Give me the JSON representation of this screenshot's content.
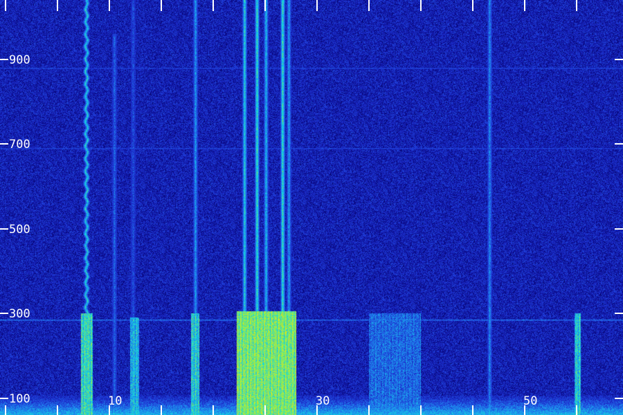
{
  "chart_data": {
    "type": "heatmap",
    "title": "",
    "xlabel": "",
    "ylabel": "",
    "x_ticks": [
      {
        "value": 0
      },
      {
        "value": 5
      },
      {
        "value": 10,
        "label": "10"
      },
      {
        "value": 15
      },
      {
        "value": 20
      },
      {
        "value": 25
      },
      {
        "value": 30,
        "label": "30"
      },
      {
        "value": 35
      },
      {
        "value": 40
      },
      {
        "value": 45
      },
      {
        "value": 50,
        "label": "50"
      },
      {
        "value": 55
      }
    ],
    "y_ticks": [
      {
        "value": 100,
        "label": "100"
      },
      {
        "value": 300,
        "label": "300"
      },
      {
        "value": 500,
        "label": "500"
      },
      {
        "value": 700,
        "label": "700"
      },
      {
        "value": 900,
        "label": "900"
      }
    ],
    "xlim": [
      -0.5,
      59.5
    ],
    "ylim": [
      60,
      1040
    ],
    "grid": false,
    "colormap": [
      "#000014",
      "#0a0a8c",
      "#1e32d2",
      "#1e8cf0",
      "#14dcdc",
      "#a0f03c",
      "#f0e614",
      "#e63c14"
    ],
    "background_intensity": 0.22,
    "features": [
      {
        "kind": "vertical_band",
        "x": 7.8,
        "y_from": 60,
        "y_to": 1040,
        "intensity": 0.55,
        "wobbly": true
      },
      {
        "kind": "vertical_band",
        "x": 10.5,
        "y_from": 60,
        "y_to": 960,
        "intensity": 0.36
      },
      {
        "kind": "vertical_band",
        "x": 12.3,
        "y_from": 60,
        "y_to": 1040,
        "intensity": 0.32
      },
      {
        "kind": "vertical_band",
        "x": 18.3,
        "y_from": 60,
        "y_to": 1040,
        "intensity": 0.45
      },
      {
        "kind": "vertical_band",
        "x": 23.0,
        "y_from": 60,
        "y_to": 1040,
        "intensity": 0.55
      },
      {
        "kind": "vertical_band",
        "x": 24.2,
        "y_from": 60,
        "y_to": 1040,
        "intensity": 0.6
      },
      {
        "kind": "vertical_band",
        "x": 25.1,
        "y_from": 60,
        "y_to": 1040,
        "intensity": 0.5
      },
      {
        "kind": "vertical_band",
        "x": 26.7,
        "y_from": 60,
        "y_to": 1040,
        "intensity": 0.6
      },
      {
        "kind": "vertical_band",
        "x": 27.3,
        "y_from": 60,
        "y_to": 1040,
        "intensity": 0.45
      },
      {
        "kind": "vertical_band",
        "x": 46.6,
        "y_from": 60,
        "y_to": 1040,
        "intensity": 0.42
      },
      {
        "kind": "hot_block",
        "x_from": 22.3,
        "x_to": 28.0,
        "y_from": 60,
        "y_to": 305,
        "intensity": 0.82
      },
      {
        "kind": "hot_block",
        "x_from": 7.3,
        "x_to": 8.4,
        "y_from": 60,
        "y_to": 300,
        "intensity": 0.7
      },
      {
        "kind": "hot_block",
        "x_from": 12.0,
        "x_to": 12.9,
        "y_from": 60,
        "y_to": 290,
        "intensity": 0.6
      },
      {
        "kind": "hot_block",
        "x_from": 17.9,
        "x_to": 18.7,
        "y_from": 60,
        "y_to": 300,
        "intensity": 0.65
      },
      {
        "kind": "hot_block",
        "x_from": 35.0,
        "x_to": 40.0,
        "y_from": 60,
        "y_to": 300,
        "intensity": 0.45
      },
      {
        "kind": "hot_block",
        "x_from": 54.8,
        "x_to": 55.4,
        "y_from": 60,
        "y_to": 300,
        "intensity": 0.65
      },
      {
        "kind": "floor_band",
        "y_from": 60,
        "y_to": 105,
        "intensity": 0.5
      },
      {
        "kind": "horizontal_line",
        "y": 285,
        "intensity": 0.38
      },
      {
        "kind": "horizontal_line",
        "y": 690,
        "intensity": 0.3
      },
      {
        "kind": "horizontal_line",
        "y": 880,
        "intensity": 0.3
      }
    ]
  }
}
